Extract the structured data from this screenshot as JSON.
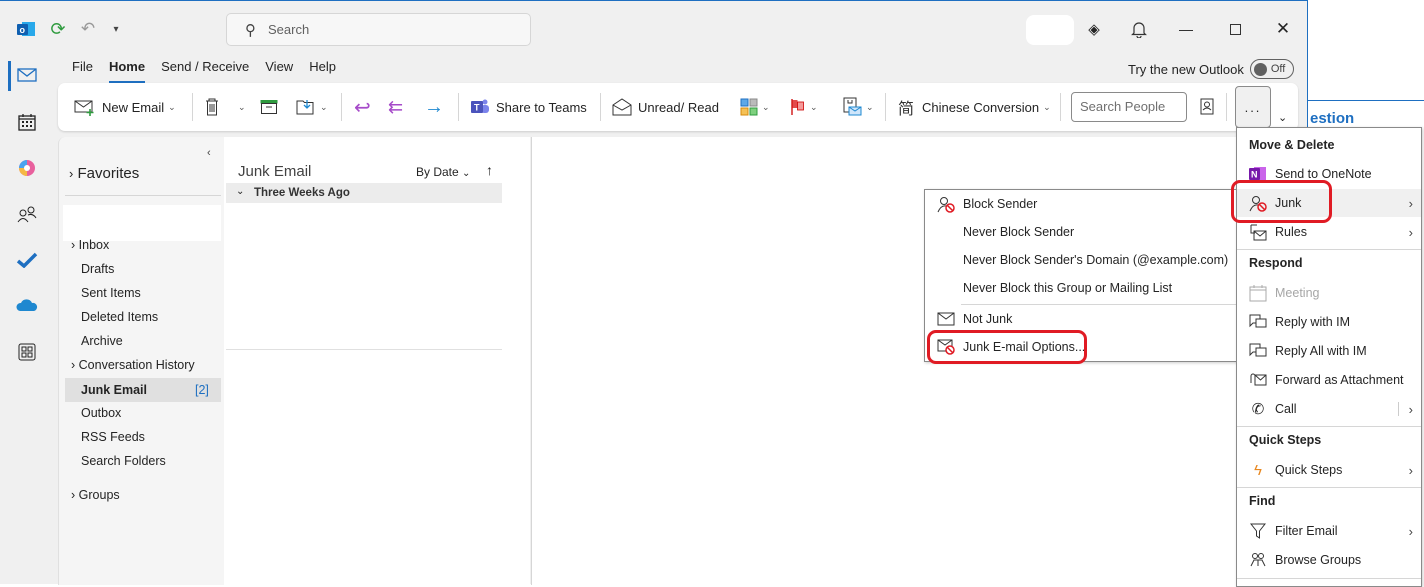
{
  "titlebar": {
    "search_placeholder": "Search",
    "qat": [
      "outlook-logo",
      "sync",
      "undo",
      "customize"
    ],
    "controls": [
      "premium",
      "notifications",
      "minimize",
      "maximize",
      "close"
    ]
  },
  "menubar": {
    "tabs": [
      "File",
      "Home",
      "Send / Receive",
      "View",
      "Help"
    ],
    "active": "Home",
    "try_new_label": "Try the new Outlook",
    "toggle_label": "Off"
  },
  "ribbon": {
    "new_email": "New Email",
    "share_teams": "Share to Teams",
    "unread_read": "Unread/ Read",
    "chinese_conversion": "Chinese Conversion",
    "search_people_placeholder": "Search People",
    "more_label": "..."
  },
  "background": {
    "partial_heading": "estion"
  },
  "folders": {
    "favorites": "Favorites",
    "items": [
      {
        "label": "Inbox",
        "expander": true
      },
      {
        "label": "Drafts"
      },
      {
        "label": "Sent Items"
      },
      {
        "label": "Deleted Items"
      },
      {
        "label": "Archive"
      },
      {
        "label": "Conversation History",
        "expander": true
      },
      {
        "label": "Junk Email",
        "count": "[2]",
        "selected": true
      },
      {
        "label": "Outbox"
      },
      {
        "label": "RSS Feeds"
      },
      {
        "label": "Search Folders"
      }
    ],
    "groups": "Groups"
  },
  "message_list": {
    "title": "Junk Email",
    "sort": "By Date",
    "group_header": "Three Weeks Ago"
  },
  "junk_submenu": {
    "items": [
      {
        "label": "Block Sender",
        "icon": "block-sender-icon"
      },
      {
        "label": "Never Block Sender"
      },
      {
        "label": "Never Block Sender's Domain (@example.com)"
      },
      {
        "label": "Never Block this Group or Mailing List"
      },
      {
        "label": "Not Junk",
        "icon": "envelope-icon"
      },
      {
        "label": "Junk E-mail Options...",
        "icon": "junk-options-icon",
        "highlighted": true
      }
    ]
  },
  "overflow_menu": {
    "sections": [
      {
        "header": "Move & Delete",
        "items": [
          {
            "label": "Send to OneNote"
          },
          {
            "label": "Junk",
            "submenu": true,
            "highlighted": true
          },
          {
            "label": "Rules",
            "submenu": true
          }
        ]
      },
      {
        "header": "Respond",
        "items": [
          {
            "label": "Meeting",
            "disabled": true
          },
          {
            "label": "Reply with IM"
          },
          {
            "label": "Reply All with IM"
          },
          {
            "label": "Forward as Attachment"
          },
          {
            "label": "Call",
            "submenu": true
          }
        ]
      },
      {
        "header": "Quick Steps",
        "items": [
          {
            "label": "Quick Steps",
            "submenu": true
          }
        ]
      },
      {
        "header": "Find",
        "items": [
          {
            "label": "Filter Email",
            "submenu": true
          },
          {
            "label": "Browse Groups"
          }
        ]
      }
    ]
  },
  "colors": {
    "accent": "#1e6fc1",
    "highlight_box": "#e01b24"
  }
}
